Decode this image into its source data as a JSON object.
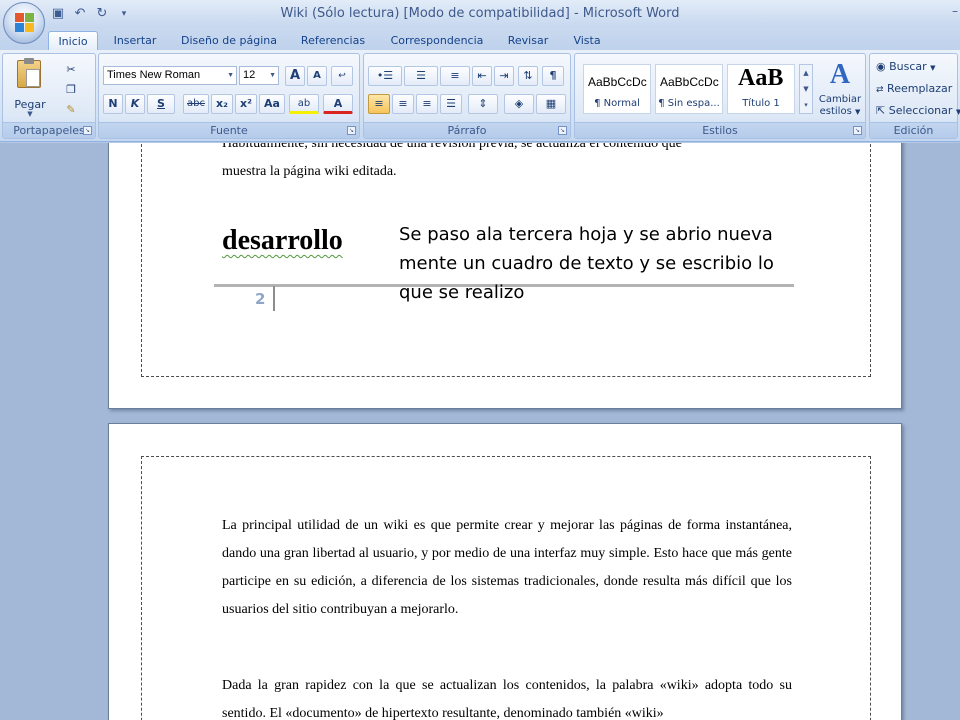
{
  "window": {
    "title": "Wiki (Sólo lectura) [Modo de compatibilidad] - Microsoft Word",
    "minimize": "–"
  },
  "quick_access": {
    "save_icon": "save-icon",
    "undo_icon": "undo-icon",
    "redo_icon": "redo-icon"
  },
  "tabs": [
    {
      "label": "Inicio",
      "active": true
    },
    {
      "label": "Insertar"
    },
    {
      "label": "Diseño de página"
    },
    {
      "label": "Referencias"
    },
    {
      "label": "Correspondencia"
    },
    {
      "label": "Revisar"
    },
    {
      "label": "Vista"
    }
  ],
  "ribbon": {
    "portapapeles": {
      "label": "Portapapeles",
      "paste": "Pegar"
    },
    "fuente": {
      "label": "Fuente",
      "font_name": "Times New Roman",
      "font_size": "12",
      "bold": "N",
      "italic": "K",
      "underline": "S",
      "strike": "abc",
      "subscript": "x₂",
      "superscript": "x²",
      "case": "Aa",
      "highlight": "ab",
      "font_color": "A",
      "grow": "A",
      "shrink": "A"
    },
    "parrafo": {
      "label": "Párrafo",
      "pilcrow": "¶"
    },
    "estilos": {
      "label": "Estilos",
      "items": [
        {
          "sample": "AaBbCcDc",
          "name": "¶ Normal"
        },
        {
          "sample": "AaBbCcDc",
          "name": "¶ Sin espa..."
        },
        {
          "sample": "AaB",
          "name": "Título 1"
        }
      ],
      "change_styles_1": "Cambiar",
      "change_styles_2": "estilos"
    },
    "edicion": {
      "label": "Edición",
      "find": "Buscar",
      "replace": "Reemplazar",
      "select": "Seleccionar"
    }
  },
  "document": {
    "page1_line1": "Habitualmente, sin necesidad de una revisión previa, se actualiza el contenido que",
    "page1_line2": "muestra la página wiki editada.",
    "heading": "desarrollo",
    "page_number": "2",
    "textbox": "Se paso ala tercera hoja y se abrio nueva mente un cuadro de texto y se escribio lo que se realizo",
    "page2_para1": "La principal utilidad de un wiki es que permite crear y mejorar las páginas de forma instantánea, dando una gran libertad al usuario, y por medio de una interfaz muy simple. Esto hace que más gente participe en su edición, a diferencia de los sistemas tradicionales, donde resulta más difícil que los usuarios del sitio contribuyan a mejorarlo.",
    "page2_para2": "Dada la gran rapidez con la que se actualizan los contenidos, la palabra «wiki» adopta todo su sentido. El «documento» de hipertexto resultante, denominado también «wiki»"
  }
}
